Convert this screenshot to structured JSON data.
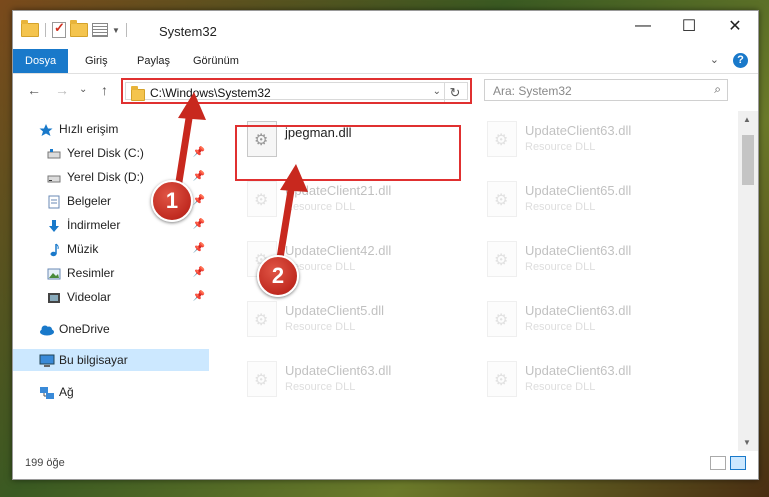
{
  "window": {
    "title": "System32",
    "controls": [
      "—",
      "☐",
      "✕"
    ]
  },
  "ribbon": {
    "tabs": [
      "Dosya",
      "Giriş",
      "Paylaş",
      "Görünüm"
    ],
    "help": "?",
    "expand": "⌄"
  },
  "navigation": {
    "back": "←",
    "forward": "→",
    "recent": "⌄",
    "up": "↑"
  },
  "address": {
    "path": "C:\\Windows\\System32",
    "dropdown": "⌄",
    "refresh": "↻"
  },
  "search": {
    "placeholder": "Ara: System32",
    "icon": "search-icon"
  },
  "sidebar": {
    "items": [
      {
        "label": "Hızlı erişim",
        "icon": "star-icon",
        "pinned": false
      },
      {
        "label": "Yerel Disk (C:)",
        "icon": "drive-icon",
        "pinned": true
      },
      {
        "label": "Yerel Disk (D:)",
        "icon": "drive-icon",
        "pinned": true
      },
      {
        "label": "Belgeler",
        "icon": "documents-icon",
        "pinned": true
      },
      {
        "label": "İndirmeler",
        "icon": "download-icon",
        "pinned": true
      },
      {
        "label": "Müzik",
        "icon": "music-icon",
        "pinned": true
      },
      {
        "label": "Resimler",
        "icon": "pictures-icon",
        "pinned": true
      },
      {
        "label": "Videolar",
        "icon": "video-icon",
        "pinned": true
      },
      {
        "label": "OneDrive",
        "icon": "cloud-icon",
        "pinned": false
      },
      {
        "label": "Bu bilgisayar",
        "icon": "computer-icon",
        "pinned": false,
        "selected": true
      },
      {
        "label": "Ağ",
        "icon": "network-icon",
        "pinned": false
      }
    ]
  },
  "files": [
    {
      "name": "jpegman.dll",
      "type": ""
    },
    {
      "name": "UpdateClient63.dll",
      "type": "Resource DLL"
    },
    {
      "name": "UpdateClient21.dll",
      "type": "Resource DLL"
    },
    {
      "name": "UpdateClient65.dll",
      "type": "Resource DLL"
    },
    {
      "name": "UpdateClient42.dll",
      "type": "Resource DLL"
    },
    {
      "name": "UpdateClient63.dll",
      "type": "Resource DLL"
    },
    {
      "name": "UpdateClient5.dll",
      "type": "Resource DLL"
    },
    {
      "name": "UpdateClient63.dll",
      "type": "Resource DLL"
    },
    {
      "name": "UpdateClient63.dll",
      "type": "Resource DLL"
    },
    {
      "name": "UpdateClient63.dll",
      "type": "Resource DLL"
    }
  ],
  "status": {
    "item_count": "199 öğe"
  },
  "annotations": {
    "step1": "1",
    "step2": "2"
  },
  "colors": {
    "accent": "#1979ca",
    "highlight": "#e03030",
    "selection": "#cce8ff"
  }
}
